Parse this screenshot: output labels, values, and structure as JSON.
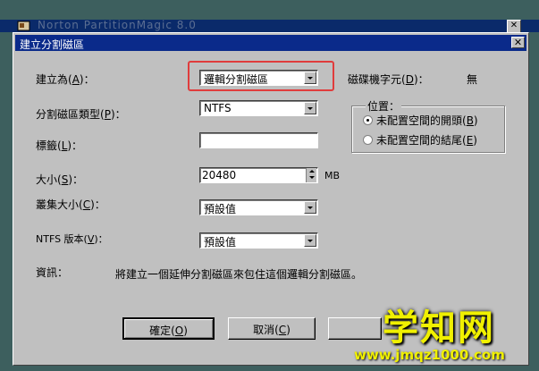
{
  "background_window": {
    "title": "Norton PartitionMagic 8.0"
  },
  "dialog": {
    "title": "建立分割磁區"
  },
  "fields": {
    "create_as": {
      "label_pre": "建立為(",
      "key": "A",
      "label_post": ")：",
      "value": "邏輯分割磁區"
    },
    "drive_letter": {
      "label_pre": "磁碟機字元(",
      "key": "D",
      "label_post": ")：",
      "value": "無"
    },
    "partition_type": {
      "label_pre": "分割磁區類型(",
      "key": "P",
      "label_post": ")：",
      "value": "NTFS"
    },
    "label": {
      "label_pre": "標籤(",
      "key": "L",
      "label_post": ")：",
      "value": ""
    },
    "size": {
      "label_pre": "大小(",
      "key": "S",
      "label_post": ")：",
      "value": "20480",
      "unit": "MB"
    },
    "cluster_size": {
      "label_pre": "叢集大小(",
      "key": "C",
      "label_post": ")：",
      "value": "預設值"
    },
    "ntfs_version": {
      "label_pre": "NTFS 版本(",
      "key": "V",
      "label_post": ")：",
      "value": "預設值"
    }
  },
  "position_group": {
    "title": "位置：",
    "options": [
      {
        "label_pre": "未配置空間的開頭(",
        "key": "B",
        "label_post": ")",
        "selected": true
      },
      {
        "label_pre": "未配置空間的結尾(",
        "key": "E",
        "label_post": ")",
        "selected": false
      }
    ]
  },
  "info": {
    "label": "資訊：",
    "text": "將建立一個延伸分割磁區來包住這個邏輯分割磁區。"
  },
  "buttons": {
    "ok": {
      "label_pre": "確定(",
      "key": "O",
      "label_post": ")"
    },
    "cancel": {
      "label_pre": "取消(",
      "key": "C",
      "label_post": ")"
    }
  },
  "watermark": {
    "main": "学知网",
    "url": "www.jmqz1000.com"
  },
  "colors": {
    "titlebar": "#0a2a8a",
    "dialog_face": "#c0c0c0",
    "highlight": "#e03c3c",
    "watermark": "#f0f000"
  }
}
